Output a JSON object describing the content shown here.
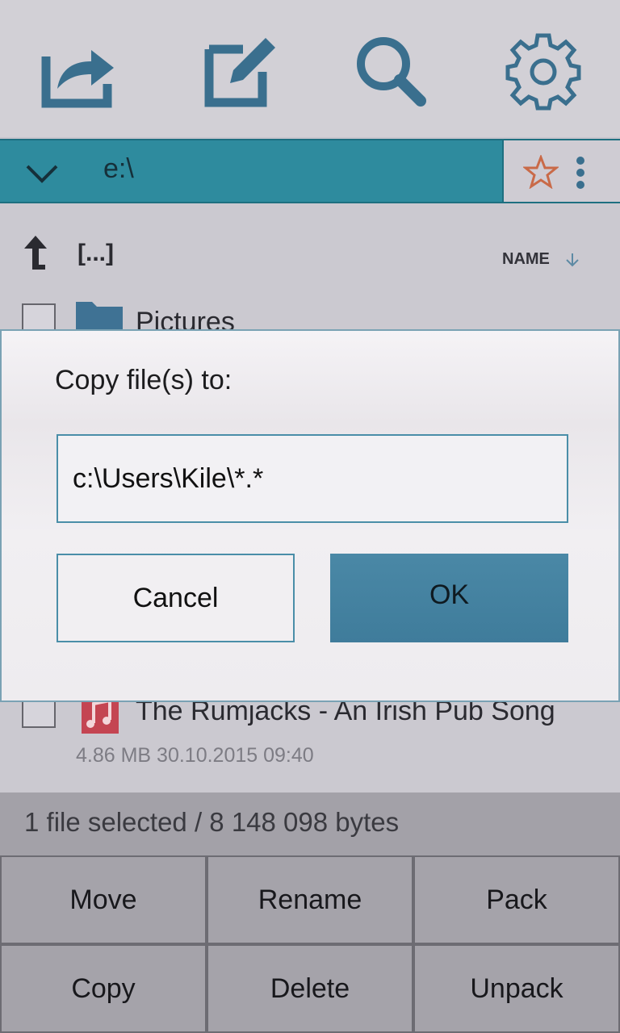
{
  "toolbar": {
    "icons": [
      "share-icon",
      "edit-icon",
      "search-icon",
      "gear-icon"
    ]
  },
  "pathbar": {
    "path": "e:\\",
    "color": "#2e8b9e"
  },
  "list": {
    "up_label": "[...]",
    "sort_label": "NAME",
    "items": [
      {
        "name": "Pictures",
        "type": "folder"
      },
      {
        "name": "The Rumjacks - An Irish Pub Song",
        "type": "music",
        "meta": "4.86 MB 30.10.2015 09:40"
      }
    ]
  },
  "status": {
    "text": "1 file selected / 8 148 098 bytes"
  },
  "actions": {
    "move": "Move",
    "rename": "Rename",
    "pack": "Pack",
    "copy": "Copy",
    "delete": "Delete",
    "unpack": "Unpack"
  },
  "dialog": {
    "title": "Copy file(s) to:",
    "destination": "c:\\Users\\Kile\\*.*",
    "cancel_label": "Cancel",
    "ok_label": "OK",
    "accent": "#4a88a6"
  }
}
